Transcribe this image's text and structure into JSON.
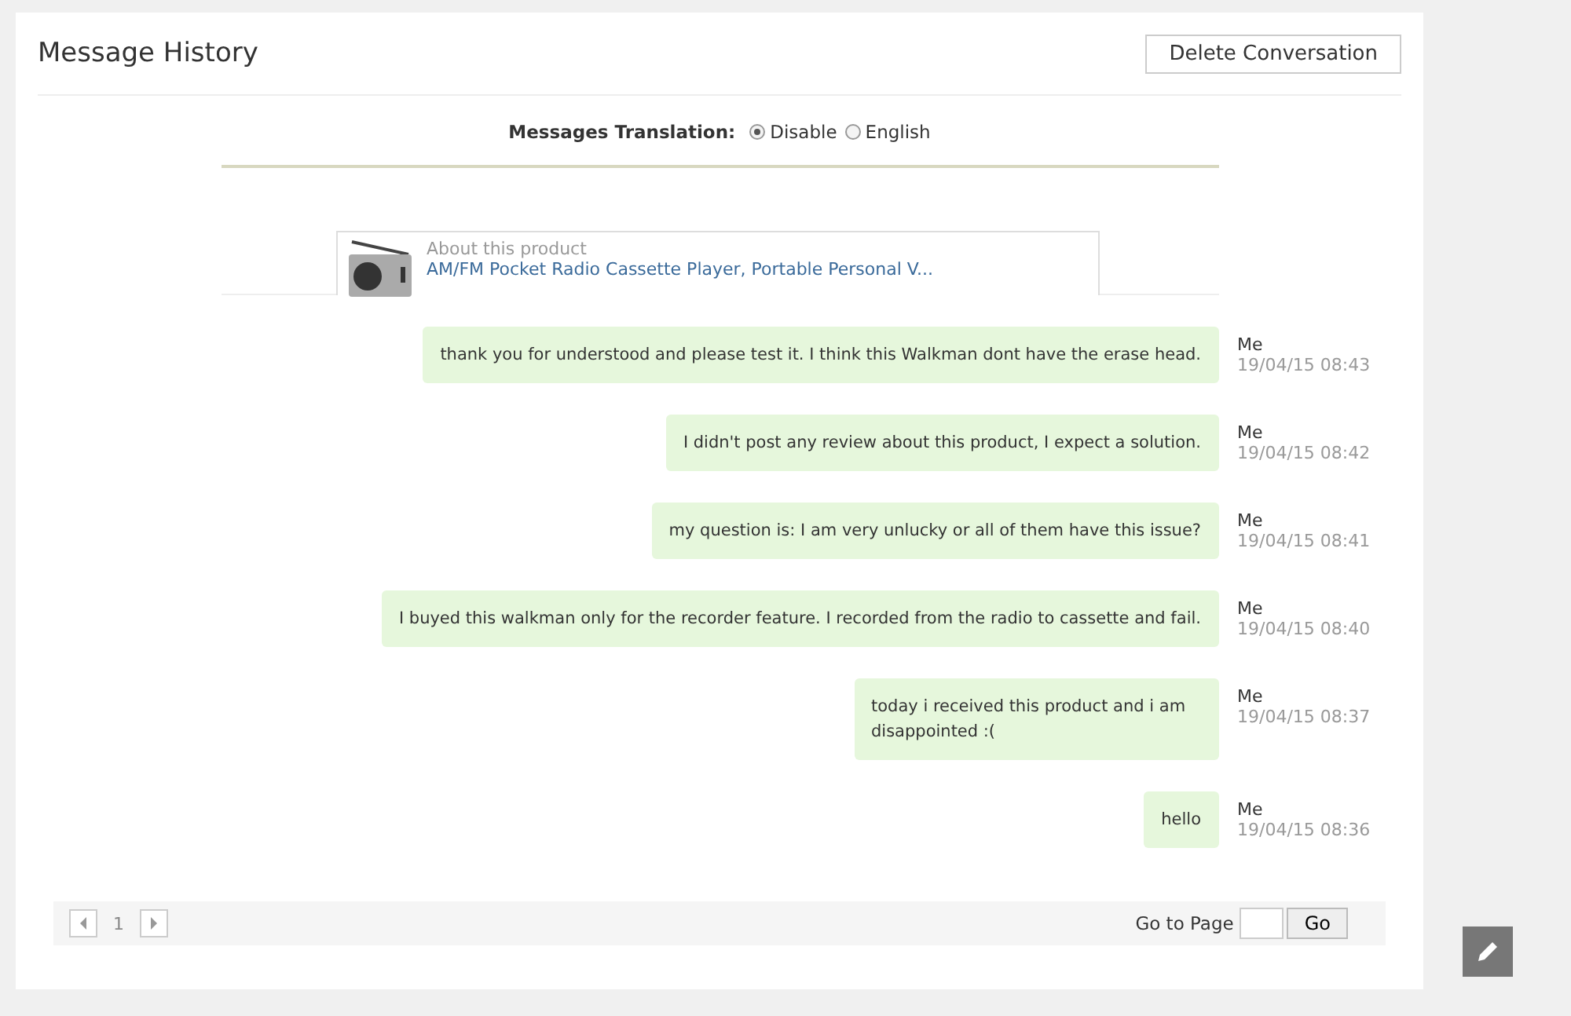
{
  "title": "Message History",
  "delete_button": "Delete Conversation",
  "translation": {
    "label": "Messages Translation:",
    "options": [
      {
        "label": "Disable",
        "selected": true
      },
      {
        "label": "English",
        "selected": false
      }
    ]
  },
  "product": {
    "caption": "About this product",
    "name": "AM/FM Pocket Radio Cassette Player, Portable Personal V..."
  },
  "messages": [
    {
      "text": "thank you for understood and please test it. I think this Walkman dont have the erase head.",
      "sender": "Me",
      "time": "19/04/15 08:43"
    },
    {
      "text": "I didn't post any review about this product, I expect a solution.",
      "sender": "Me",
      "time": "19/04/15 08:42"
    },
    {
      "text": "my question is: I am very unlucky or all of them have this issue?",
      "sender": "Me",
      "time": "19/04/15 08:41"
    },
    {
      "text": "I buyed this walkman only for the recorder feature. I recorded from the radio to cassette and fail.",
      "sender": "Me",
      "time": "19/04/15 08:40"
    },
    {
      "text": "today i received this product and i am disappointed :(",
      "sender": "Me",
      "time": "19/04/15 08:37"
    },
    {
      "text": "hello",
      "sender": "Me",
      "time": "19/04/15 08:36"
    }
  ],
  "pagination": {
    "page": "1",
    "goto_label": "Go to Page",
    "go_button": "Go"
  }
}
